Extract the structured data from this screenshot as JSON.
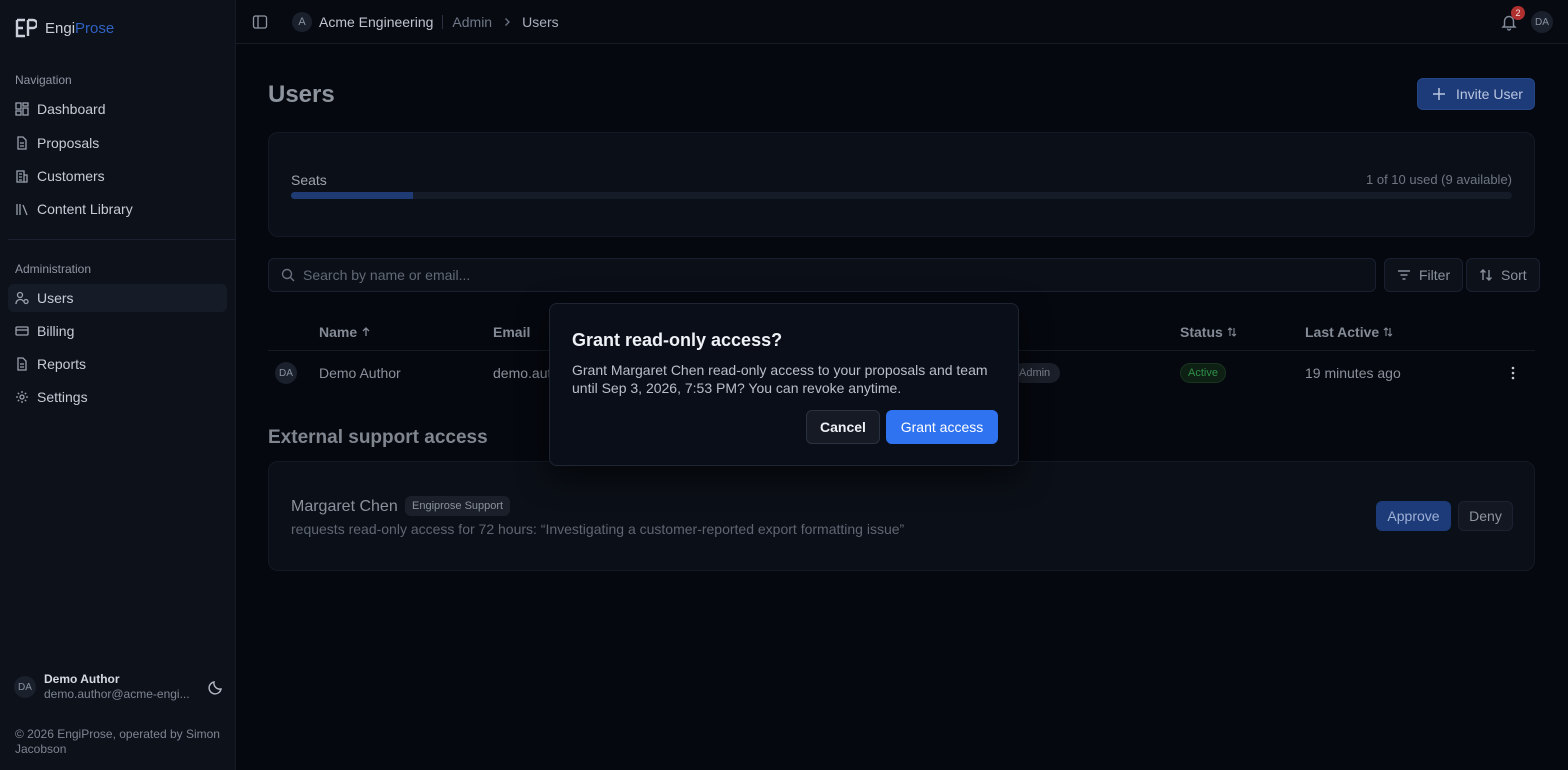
{
  "brand": {
    "name_part1": "Engi",
    "name_part2": "Prose"
  },
  "sidebar": {
    "nav_heading": "Navigation",
    "nav_items": [
      {
        "label": "Dashboard",
        "icon": "grid-icon"
      },
      {
        "label": "Proposals",
        "icon": "file-icon"
      },
      {
        "label": "Customers",
        "icon": "building-icon"
      },
      {
        "label": "Content Library",
        "icon": "library-icon"
      }
    ],
    "admin_heading": "Administration",
    "admin_items": [
      {
        "label": "Users",
        "icon": "users-icon",
        "active": true
      },
      {
        "label": "Billing",
        "icon": "credit-card-icon"
      },
      {
        "label": "Reports",
        "icon": "file-icon"
      },
      {
        "label": "Settings",
        "icon": "gear-icon"
      }
    ],
    "user": {
      "initials": "DA",
      "name": "Demo Author",
      "email": "demo.author@acme-engi..."
    },
    "copyright": "© 2026 EngiProse, operated by Simon Jacobson"
  },
  "topbar": {
    "org_initial": "A",
    "org_name": "Acme Engineering",
    "breadcrumb_parent": "Admin",
    "breadcrumb_current": "Users",
    "notification_count": "2",
    "user_initials": "DA"
  },
  "page": {
    "title": "Users",
    "invite_label": "Invite User"
  },
  "seats": {
    "label": "Seats",
    "count_text": "1 of 10 used (9 available)",
    "used_fraction": 0.1
  },
  "search": {
    "placeholder": "Search by name or email..."
  },
  "toolbar": {
    "filter_label": "Filter",
    "sort_label": "Sort"
  },
  "table": {
    "headers": {
      "name": "Name",
      "email": "Email",
      "status": "Status",
      "last_active": "Last Active"
    },
    "rows": [
      {
        "initials": "DA",
        "name": "Demo Author",
        "email": "demo.aut",
        "role": "Admin",
        "status": "Active",
        "last_active": "19 minutes ago"
      }
    ]
  },
  "external": {
    "title": "External support access",
    "request": {
      "name": "Margaret Chen",
      "badge": "Engiprose Support",
      "description": "requests read-only access for 72 hours: “Investigating a customer-reported export formatting issue”",
      "approve_label": "Approve",
      "deny_label": "Deny"
    }
  },
  "dialog": {
    "title": "Grant read-only access?",
    "body": "Grant Margaret Chen read-only access to your proposals and team until Sep 3, 2026, 7:53 PM? You can revoke anytime.",
    "cancel_label": "Cancel",
    "confirm_label": "Grant access"
  },
  "colors": {
    "accent": "#2f73f0",
    "accent_dim": "#1d3b78",
    "background": "#05080f",
    "sidebar": "#0d1119",
    "status_active": "#2f8f48",
    "badge_alert": "#b03030"
  }
}
